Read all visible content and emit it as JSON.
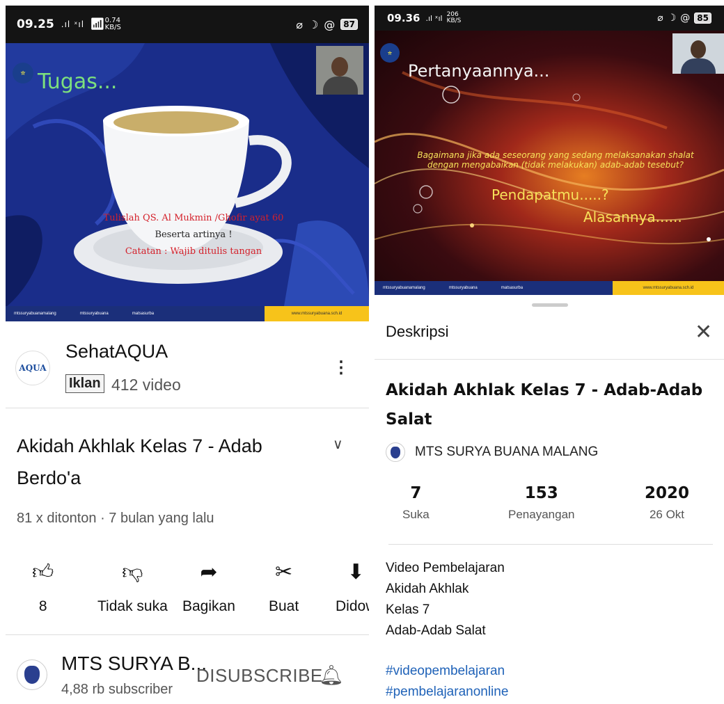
{
  "left": {
    "status": {
      "time": "09.25",
      "signal": ".ıl ˣıl",
      "net": "0.74",
      "net_unit": "KB/S",
      "battery": "87"
    },
    "video": {
      "heading": "Tugas...",
      "line1": "Tulislah QS. Al Mukmin /Ghofir ayat 60",
      "line2": "Beserta artinya !",
      "line3": "Catatan : Wajib ditulis tangan",
      "footer": [
        "mtssuryabuanamalang",
        "mtssuryabuana",
        "matsasurba",
        "www.mtssuryabuana.sch.id"
      ]
    },
    "ad": {
      "logo": "AQUA",
      "name": "SehatAQUA",
      "badge": "Iklan",
      "count": "412 video"
    },
    "title": "Akidah Akhlak Kelas 7 - Adab Berdo'a",
    "meta": "81 x ditonton · 7 bulan yang lalu",
    "actions": [
      {
        "icon": "thumbs-up-icon",
        "label": "8"
      },
      {
        "icon": "thumbs-down-icon",
        "label": "Tidak suka"
      },
      {
        "icon": "share-icon",
        "label": "Bagikan"
      },
      {
        "icon": "create-icon",
        "label": "Buat"
      },
      {
        "icon": "download-icon",
        "label": "Didow"
      }
    ],
    "subscribe": {
      "name": "MTS SURYA B...",
      "count": "4,88 rb subscriber",
      "button": "DISUBSCRIBE"
    }
  },
  "right": {
    "status": {
      "time": "09.36",
      "signal": ".ıl ˣıl",
      "net": "206",
      "net_unit": "KB/S",
      "battery": "85"
    },
    "video": {
      "heading": "Pertanyaannya...",
      "question": "Bagaimana jika ada seseorang yang sedang melaksanakan shalat dengan mengabaikan (tidak melakukan) adab-adab tesebut?",
      "pendapat": "Pendapatmu.....?",
      "alasan": "Alasannya......",
      "footer": [
        "mtssuryabuanamalang",
        "mtssuryabuana",
        "matsasurba",
        "www.mtssuryabuana.sch.id"
      ]
    },
    "sheet": {
      "title": "Deskripsi",
      "video_title": "Akidah Akhlak Kelas 7 - Adab-Adab Salat",
      "channel": "MTS SURYA BUANA MALANG",
      "stats": [
        {
          "num": "7",
          "label": "Suka"
        },
        {
          "num": "153",
          "label": "Penayangan"
        },
        {
          "num": "2020",
          "label": "26 Okt"
        }
      ],
      "desc": [
        "Video Pembelajaran",
        "Akidah Akhlak",
        "Kelas 7",
        "Adab-Adab Salat"
      ],
      "tags": [
        "#videopembelajaran",
        "#pembelajaranonline"
      ]
    }
  }
}
